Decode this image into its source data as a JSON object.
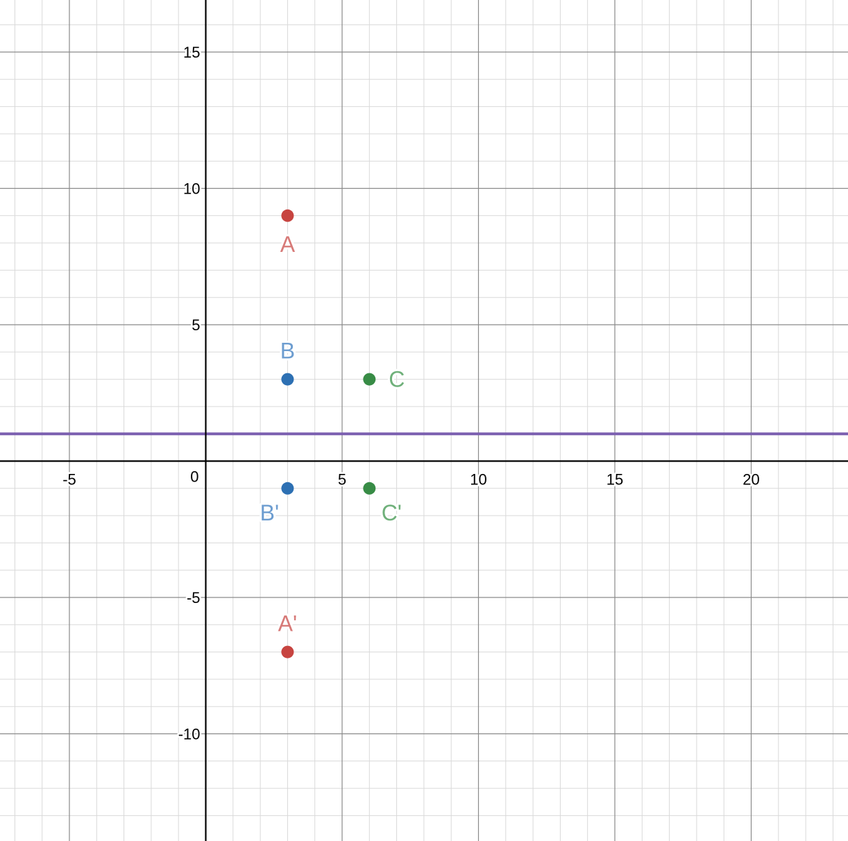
{
  "chart_data": {
    "type": "scatter",
    "xlim": [
      -7.5,
      23.6
    ],
    "ylim": [
      -14,
      17
    ],
    "grid": true,
    "major_step": 5,
    "minor_step": 1,
    "x_ticks": [
      {
        "value": -5,
        "label": "-5"
      },
      {
        "value": 5,
        "label": "5"
      },
      {
        "value": 10,
        "label": "10"
      },
      {
        "value": 15,
        "label": "15"
      },
      {
        "value": 20,
        "label": "20"
      }
    ],
    "y_ticks": [
      {
        "value": 15,
        "label": "15"
      },
      {
        "value": 10,
        "label": "10"
      },
      {
        "value": 5,
        "label": "5"
      },
      {
        "value": -5,
        "label": "-5"
      },
      {
        "value": -10,
        "label": "-10"
      }
    ],
    "origin_label": "0",
    "lines": [
      {
        "type": "horizontal",
        "y": 1,
        "color": "#7b5fb0"
      }
    ],
    "points": [
      {
        "id": "A",
        "label": "A",
        "x": 3,
        "y": 9,
        "color": "#c74440",
        "label_color": "#d77a78",
        "label_side": "below"
      },
      {
        "id": "B",
        "label": "B",
        "x": 3,
        "y": 3,
        "color": "#2d70b3",
        "label_color": "#6d9dd0",
        "label_side": "above"
      },
      {
        "id": "C",
        "label": "C",
        "x": 6,
        "y": 3,
        "color": "#388c46",
        "label_color": "#6fb07a",
        "label_side": "right"
      },
      {
        "id": "A-prime",
        "label": "A'",
        "x": 3,
        "y": -7,
        "color": "#c74440",
        "label_color": "#d77a78",
        "label_side": "above"
      },
      {
        "id": "B-prime",
        "label": "B'",
        "x": 3,
        "y": -1,
        "color": "#2d70b3",
        "label_color": "#6d9dd0",
        "label_side": "below-left"
      },
      {
        "id": "C-prime",
        "label": "C'",
        "x": 6,
        "y": -1,
        "color": "#388c46",
        "label_color": "#6fb07a",
        "label_side": "below-right"
      }
    ]
  }
}
